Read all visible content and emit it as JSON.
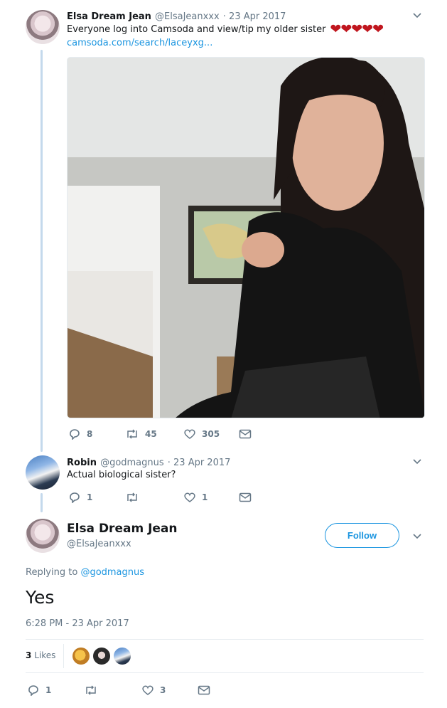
{
  "tweet1": {
    "name": "Elsa Dream Jean",
    "handle": "@ElsaJeanxxx",
    "date": "· 23 Apr 2017",
    "text": "Everyone log into Camsoda and view/tip my older sister",
    "hearts": "❤❤❤❤❤",
    "link": "camsoda.com/search/laceyxg...",
    "actions": {
      "replies": "8",
      "retweets": "45",
      "likes": "305"
    }
  },
  "tweet2": {
    "name": "Robin",
    "handle": "@godmagnus",
    "date": "· 23 Apr 2017",
    "text": "Actual biological sister?",
    "actions": {
      "replies": "1",
      "retweets": "",
      "likes": "1"
    }
  },
  "main": {
    "name": "Elsa Dream Jean",
    "handle": "@ElsaJeanxxx",
    "follow_label": "Follow",
    "replying_prefix": "Replying to",
    "replying_handle": "@godmagnus",
    "text": "Yes",
    "timestamp": "6:28 PM - 23 Apr 2017",
    "likes_count": "3",
    "likes_label": "Likes",
    "actions": {
      "replies": "1",
      "retweets": "",
      "likes": "3"
    }
  },
  "colors": {
    "accent": "#1b95e0",
    "heart": "#c0161e",
    "muted": "#657786",
    "thread": "#c4d9ec"
  }
}
